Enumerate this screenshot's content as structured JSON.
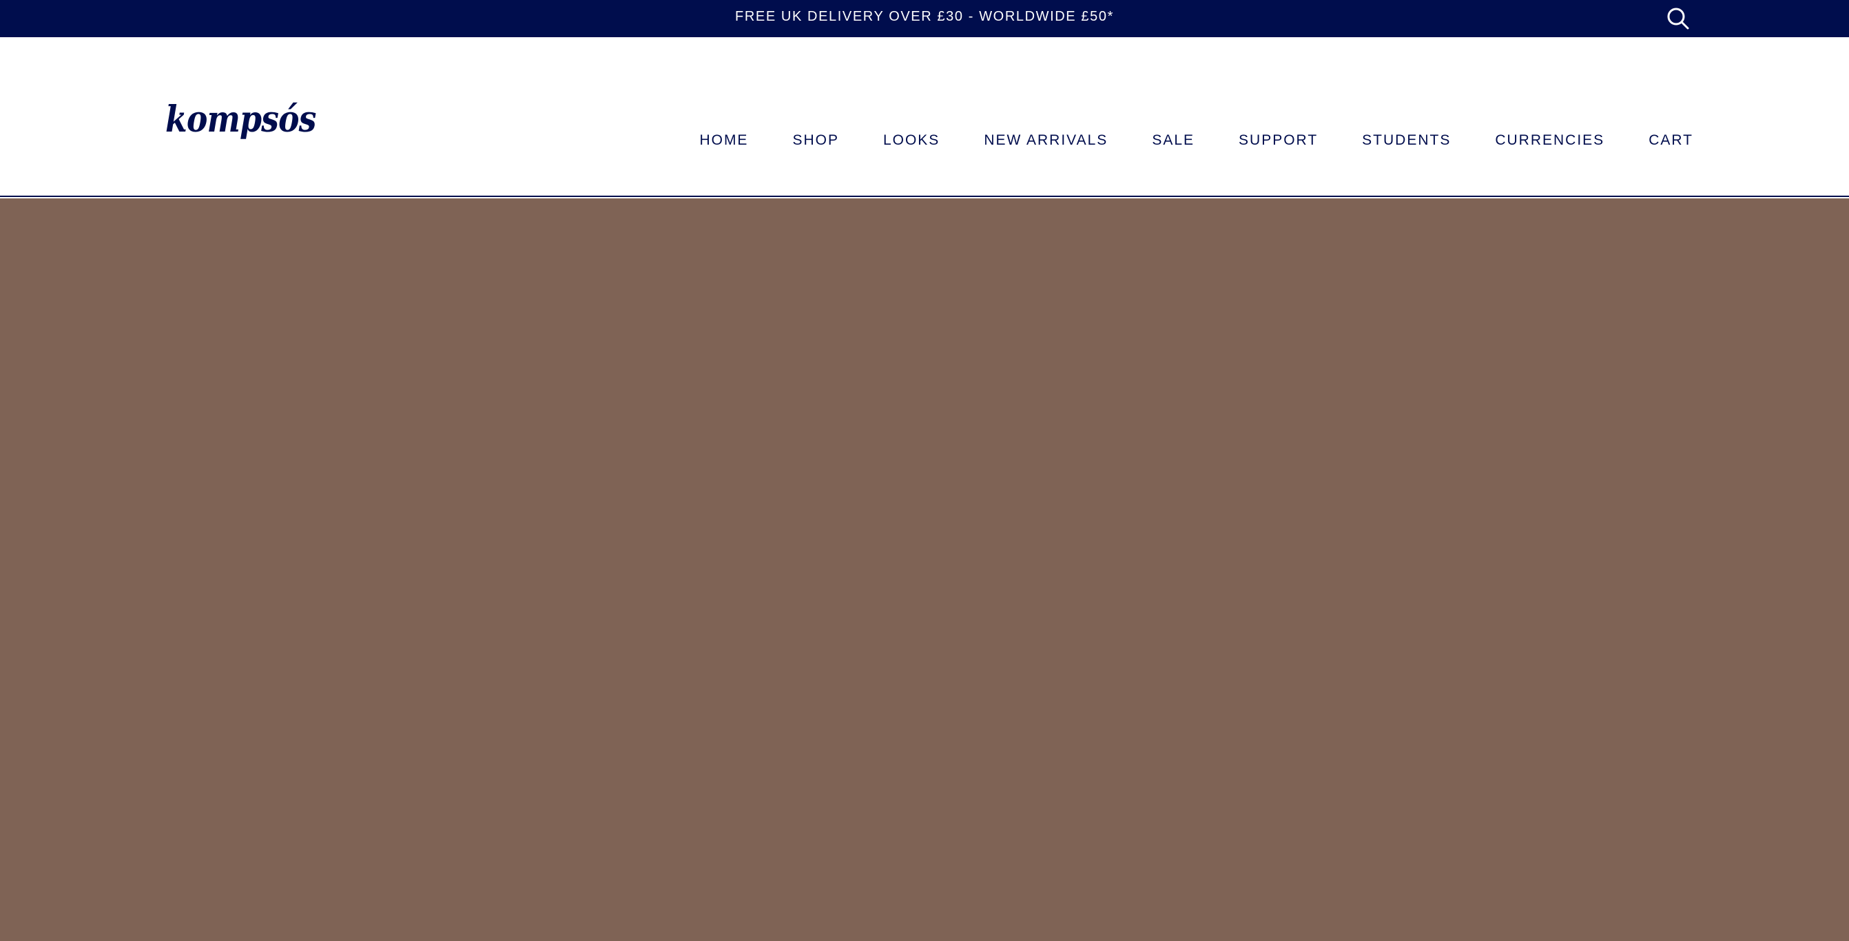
{
  "announcement": {
    "text": "FREE UK DELIVERY OVER £30 - WORLDWIDE £50*",
    "background": "#000d4d",
    "text_color": "#ffffff"
  },
  "search": {
    "icon": "search-icon"
  },
  "header": {
    "logo_text": "kompsós",
    "brand_color": "#000d4d"
  },
  "nav": {
    "items": [
      {
        "label": "HOME"
      },
      {
        "label": "SHOP"
      },
      {
        "label": "LOOKS"
      },
      {
        "label": "NEW ARRIVALS"
      },
      {
        "label": "SALE"
      },
      {
        "label": "SUPPORT"
      },
      {
        "label": "STUDENTS"
      },
      {
        "label": "CURRENCIES"
      },
      {
        "label": "CART"
      }
    ]
  },
  "hero": {
    "background": "#7f6355"
  }
}
